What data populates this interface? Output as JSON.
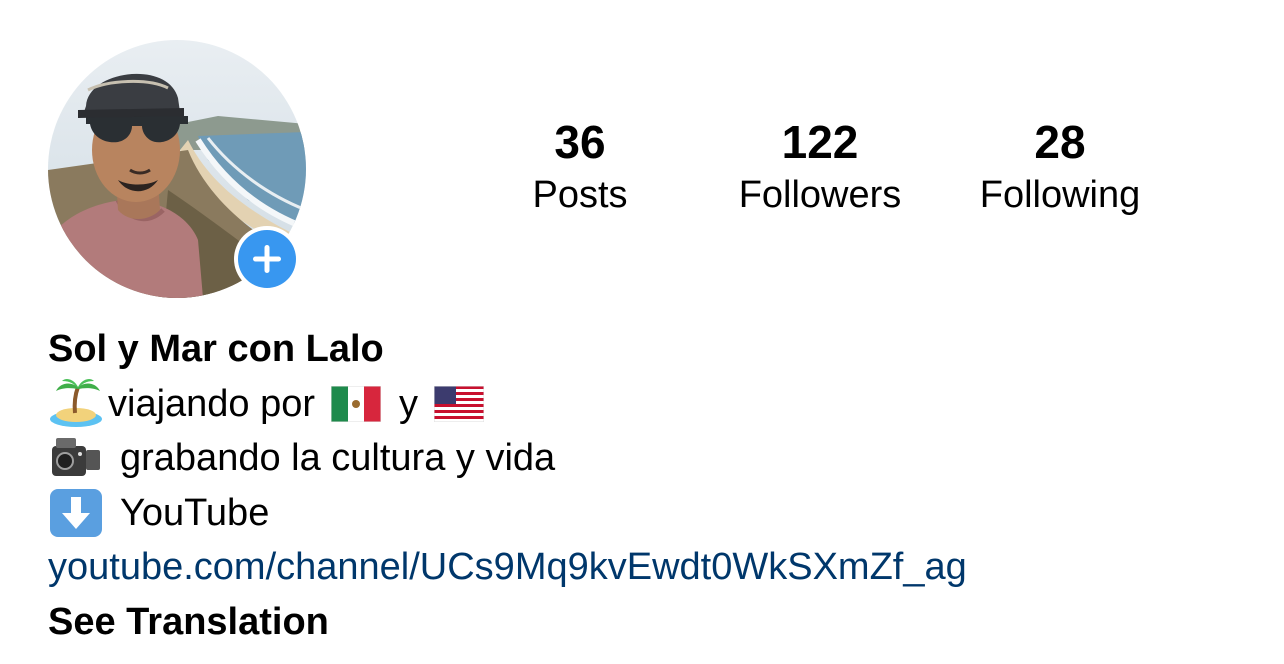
{
  "profile": {
    "avatar_icon": "profile-photo",
    "add_story_icon": "plus-icon",
    "add_story_color": "#3897f0"
  },
  "stats": {
    "posts": {
      "value": "36",
      "label": "Posts"
    },
    "followers": {
      "value": "122",
      "label": "Followers"
    },
    "following": {
      "value": "28",
      "label": "Following"
    }
  },
  "bio": {
    "name": "Sol y Mar con Lalo",
    "line1_text_a": "viajando por",
    "line1_text_b": "y",
    "line2_text": "grabando la cultura y vida",
    "line3_text": "YouTube",
    "link": "youtube.com/channel/UCs9Mq9kvEwdt0WkSXmZf_ag",
    "link_color": "#00376b",
    "see_translation": "See Translation",
    "icons": [
      "island-icon",
      "mexico-flag-icon",
      "usa-flag-icon",
      "video-camera-icon",
      "down-arrow-icon"
    ]
  }
}
